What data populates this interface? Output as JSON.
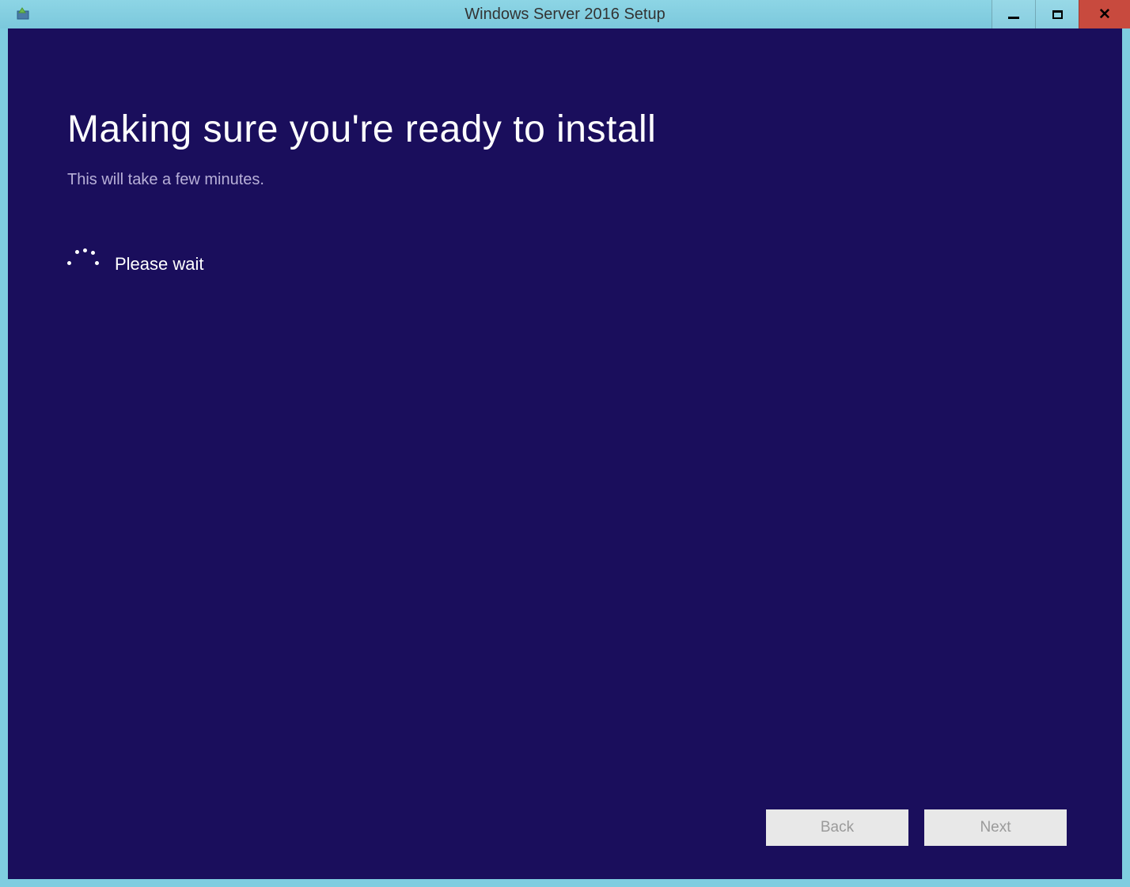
{
  "window": {
    "title": "Windows Server 2016 Setup"
  },
  "main": {
    "heading": "Making sure you're ready to install",
    "subheading": "This will take a few minutes.",
    "progress_text": "Please wait"
  },
  "buttons": {
    "back": "Back",
    "next": "Next"
  }
}
